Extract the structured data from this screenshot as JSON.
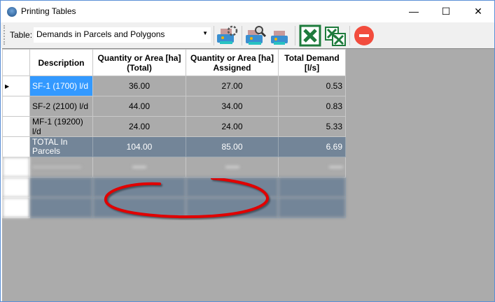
{
  "window": {
    "title": "Printing Tables",
    "minimize": "—",
    "maximize": "☐",
    "close": "✕"
  },
  "toolbar": {
    "table_label": "Table:",
    "table_value": "Demands in Parcels and Polygons",
    "buttons": [
      "print-settings-icon",
      "print-preview-icon",
      "print-icon",
      "export-excel-icon",
      "export-excel-multiple-icon",
      "close-red-icon"
    ]
  },
  "table": {
    "headers": [
      "Description",
      "Quantity or Area [ha] (Total)",
      "Quantity or Area [ha] Assigned",
      "Total Demand [l/s]"
    ],
    "rows": [
      {
        "desc": "SF-1 (1700) l/d",
        "total": "36.00",
        "assigned": "27.00",
        "demand": "0.53"
      },
      {
        "desc": "SF-2 (2100) l/d",
        "total": "44.00",
        "assigned": "34.00",
        "demand": "0.83"
      },
      {
        "desc": "MF-1 (19200) l/d",
        "total": "24.00",
        "assigned": "24.00",
        "demand": "5.33"
      },
      {
        "desc": "TOTAL In Parcels",
        "total": "104.00",
        "assigned": "85.00",
        "demand": "6.69"
      }
    ],
    "row_indicator": "▶"
  },
  "colors": {
    "total_row": "#738598",
    "selected": "#3399ff",
    "annotation": "#e00000"
  }
}
